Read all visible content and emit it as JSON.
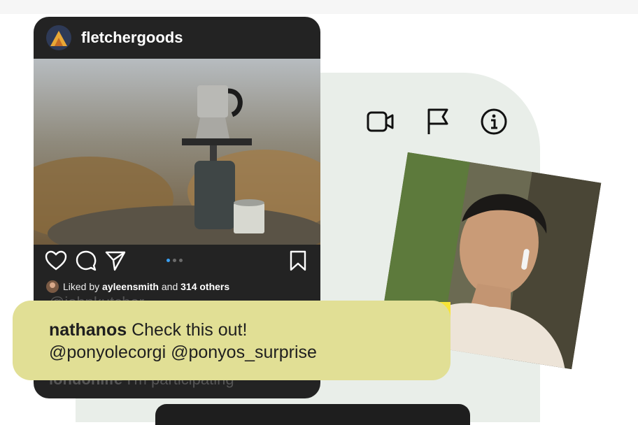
{
  "post": {
    "username": "fletchergoods",
    "liked_prefix": "Liked by",
    "liked_user": "ayleensmith",
    "liked_and": "and",
    "liked_others": "314 others",
    "carousel_total": 3,
    "carousel_active": 1
  },
  "comments_behind": [
    {
      "user": "@johnkutcher",
      "text": ""
    },
    {
      "user": "londonlife",
      "text": "I'm participating"
    }
  ],
  "bubble": {
    "user": "nathanos",
    "line1": "Check this out!",
    "line2": "@ponyolecorgi @ponyos_surprise"
  },
  "icons": [
    "video-call-icon",
    "flag-icon",
    "info-icon"
  ],
  "colors": {
    "post_bg": "#232323",
    "panel_bg": "#e9eee9",
    "bubble_bg": "#e1df95",
    "accent_yellow": "#f7e437",
    "carousel_active": "#3aa0f3"
  }
}
